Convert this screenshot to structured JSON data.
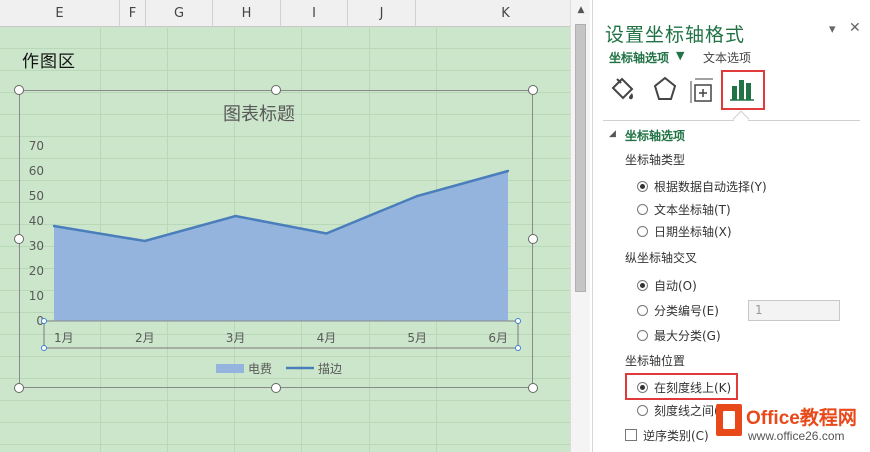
{
  "sheet": {
    "columns": [
      "E",
      "F",
      "G",
      "H",
      "I",
      "J",
      "K"
    ],
    "plot_area_label": "作图区"
  },
  "pane": {
    "title": "设置坐标轴格式",
    "tabs": {
      "axis_options": "坐标轴选项",
      "text_options": "文本选项"
    },
    "controls": {
      "dropdown": "▾",
      "close": "✕"
    },
    "section": "坐标轴选项",
    "axis_type": {
      "label": "坐标轴类型",
      "options": [
        {
          "label": "根据数据自动选择(Y)",
          "selected": true
        },
        {
          "label": "文本坐标轴(T)",
          "selected": false
        },
        {
          "label": "日期坐标轴(X)",
          "selected": false
        }
      ]
    },
    "vertical_cross": {
      "label": "纵坐标轴交叉",
      "options": [
        {
          "label": "自动(O)",
          "selected": true
        },
        {
          "label": "分类编号(E)",
          "selected": false
        },
        {
          "label": "最大分类(G)",
          "selected": false
        }
      ],
      "category_number_value": "1"
    },
    "axis_position": {
      "label": "坐标轴位置",
      "options": [
        {
          "label": "在刻度线上(K)",
          "selected": true
        },
        {
          "label": "刻度线之间(W)",
          "selected": false
        }
      ]
    },
    "reverse_order": {
      "label": "逆序类别(C)",
      "checked": false
    }
  },
  "watermark": {
    "title": "Office教程网",
    "url": "www.office26.com"
  },
  "colors": {
    "accent": "#217346",
    "highlight": "#e03a3a",
    "area_fill": "#94b4de",
    "line": "#4a7ebb"
  },
  "chart_data": {
    "type": "area",
    "title": "图表标题",
    "categories": [
      "1月",
      "2月",
      "3月",
      "4月",
      "5月",
      "6月"
    ],
    "series": [
      {
        "name": "电费",
        "type": "area",
        "values": [
          38,
          32,
          42,
          35,
          50,
          60
        ]
      },
      {
        "name": "描边",
        "type": "line",
        "values": [
          38,
          32,
          42,
          35,
          50,
          60
        ]
      }
    ],
    "yticks": [
      0,
      10,
      20,
      30,
      40,
      50,
      60,
      70
    ],
    "ylim": [
      0,
      70
    ],
    "grid": false,
    "legend": "bottom"
  }
}
